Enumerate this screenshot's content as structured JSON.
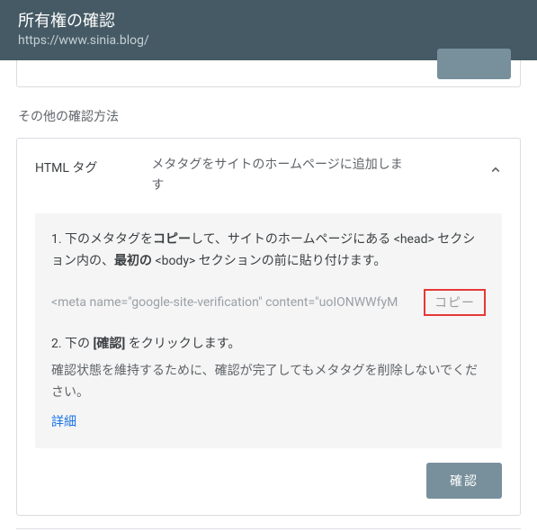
{
  "header": {
    "title": "所有権の確認",
    "url": "https://www.sinia.blog/"
  },
  "section_title": "その他の確認方法",
  "method": {
    "name": "HTML タグ",
    "description": "メタタグをサイトのホームページに追加します"
  },
  "panel": {
    "step1_prefix": "1. 下のメタタグを",
    "step1_bold1": "コピー",
    "step1_mid": "して、サイトのホームページにある <head> セクション内の、",
    "step1_bold2": "最初の",
    "step1_suffix": " <body> セクションの前に貼り付けます。",
    "meta_code": "<meta name=\"google-site-verification\" content=\"uoIONWWfyM",
    "copy_label": "コピー",
    "step2_prefix": "2. 下の ",
    "step2_bold": "[確認]",
    "step2_suffix": " をクリックします。",
    "note": "確認状態を維持するために、確認が完了してもメタタグを削除しないでください。",
    "details_label": "詳細"
  },
  "confirm_label": "確認"
}
